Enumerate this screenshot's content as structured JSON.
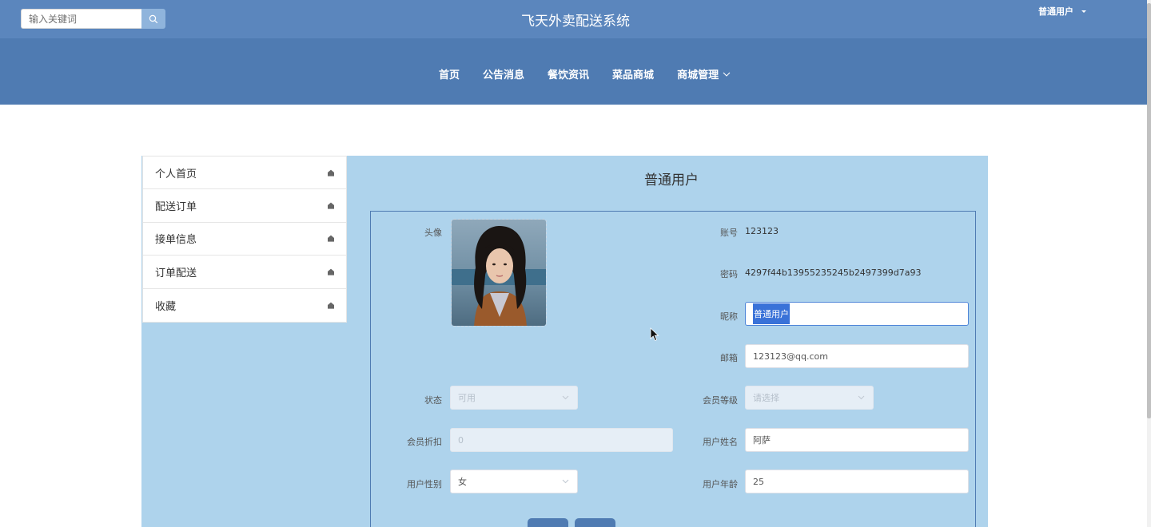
{
  "header": {
    "search_placeholder": "输入关键词",
    "title": "飞天外卖配送系统",
    "user": "普通用户"
  },
  "nav": {
    "items": [
      {
        "label": "首页"
      },
      {
        "label": "公告消息"
      },
      {
        "label": "餐饮资讯"
      },
      {
        "label": "菜品商城"
      },
      {
        "label": "商城管理"
      }
    ]
  },
  "sidebar": {
    "items": [
      {
        "label": "个人首页"
      },
      {
        "label": "配送订单"
      },
      {
        "label": "接单信息"
      },
      {
        "label": "订单配送"
      },
      {
        "label": "收藏"
      }
    ]
  },
  "profile": {
    "title": "普通用户",
    "avatar_label": "头像",
    "account_label": "账号",
    "account_value": "123123",
    "password_label": "密码",
    "password_value": "4297f44b13955235245b2497399d7a93",
    "nickname_label": "昵称",
    "nickname_value": "普通用户",
    "email_label": "邮箱",
    "email_value": "123123@qq.com",
    "status_label": "状态",
    "status_value": "可用",
    "level_label": "会员等级",
    "level_placeholder": "请选择",
    "discount_label": "会员折扣",
    "discount_value": "0",
    "name_label": "用户姓名",
    "name_value": "阿萨",
    "gender_label": "用户性别",
    "gender_value": "女",
    "age_label": "用户年龄",
    "age_value": "25"
  },
  "colors": {
    "topbar": "#5b86bd",
    "navbar": "#4f7bb2",
    "content_bg": "#aed3ec",
    "selection": "#3a72d8"
  }
}
